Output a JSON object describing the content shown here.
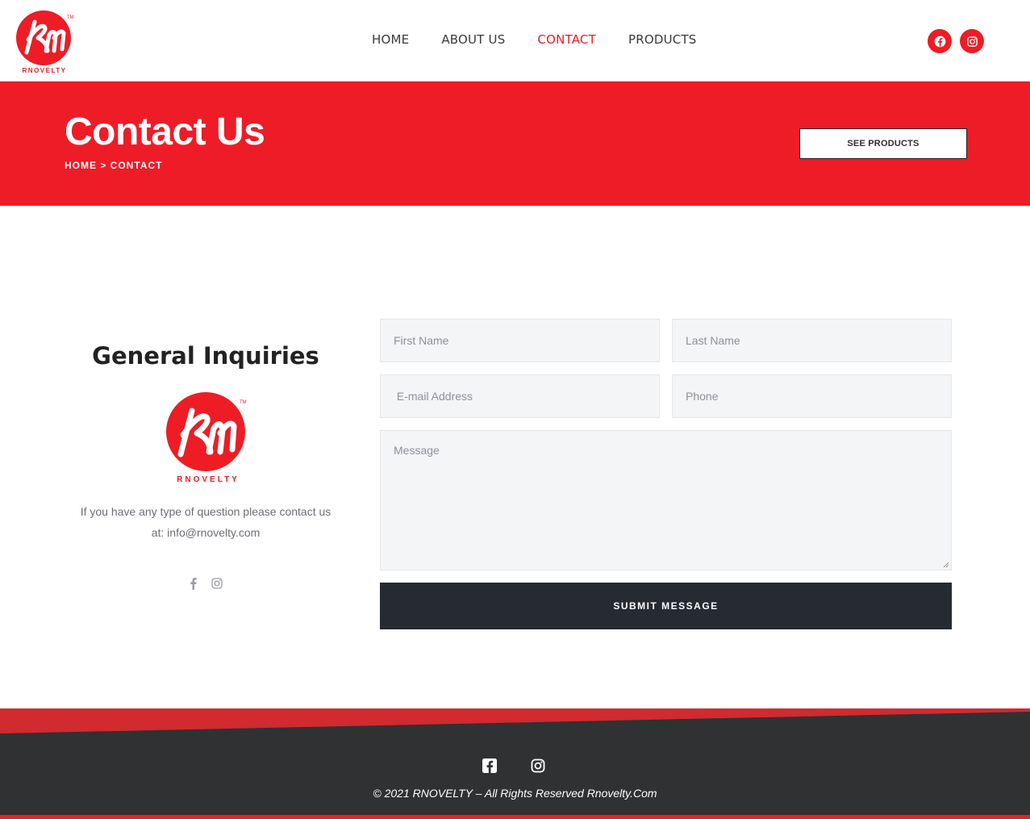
{
  "brand": {
    "logo_text": "RNOVELTY",
    "accent_color": "#ee1c25"
  },
  "nav": {
    "items": [
      {
        "label": "HOME",
        "active": false
      },
      {
        "label": "ABOUT US",
        "active": false
      },
      {
        "label": "CONTACT",
        "active": true
      },
      {
        "label": "PRODUCTS",
        "active": false
      }
    ]
  },
  "header_social": {
    "icons": [
      "facebook-icon",
      "instagram-icon"
    ]
  },
  "hero": {
    "title": "Contact Us",
    "breadcrumb": "HOME > CONTACT",
    "button_label": "SEE PRODUCTS",
    "background_color": "#ee1c27"
  },
  "inquiries": {
    "title": "General Inquiries",
    "text": "If you have any type of question please contact us at:  info@rnovelty.com",
    "social_icons": [
      "facebook-icon",
      "instagram-icon"
    ]
  },
  "form": {
    "first_name_placeholder": "First Name",
    "last_name_placeholder": "Last Name",
    "email_placeholder": " E-mail Address",
    "phone_placeholder": "Phone",
    "message_placeholder": "Message",
    "submit_label": "SUBMIT MESSAGE",
    "submit_color": "#262a31"
  },
  "footer": {
    "social_icons": [
      "facebook-square-icon",
      "instagram-icon"
    ],
    "copyright": "© 2021 RNOVELTY – All Rights Reserved Rnovelty.Com",
    "background_color": "#303133",
    "stripe_color": "#d12a2f"
  }
}
